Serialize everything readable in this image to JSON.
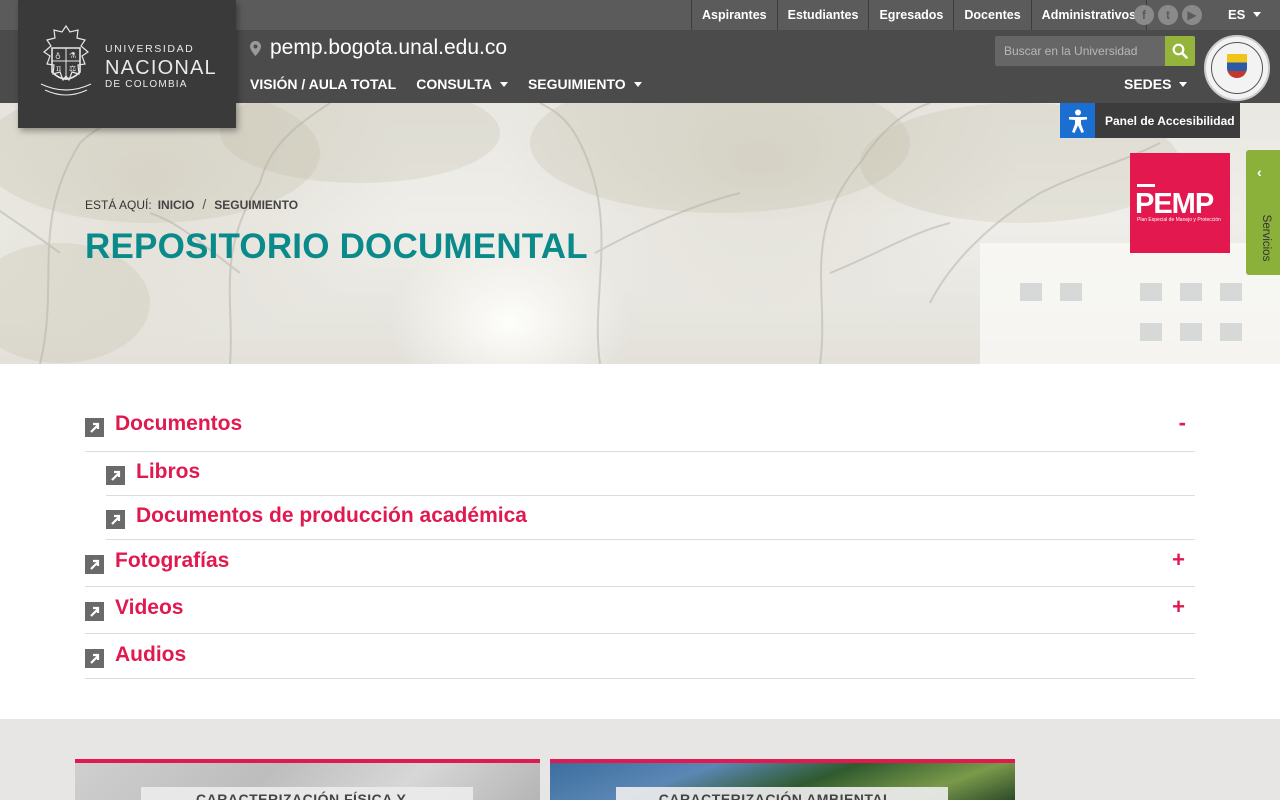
{
  "university": {
    "line1": "UNIVERSIDAD",
    "line2": "NACIONAL",
    "line3": "DE COLOMBIA"
  },
  "top_links": [
    "Aspirantes",
    "Estudiantes",
    "Egresados",
    "Docentes",
    "Administrativos"
  ],
  "social_icons": [
    "facebook-icon",
    "twitter-icon",
    "youtube-icon"
  ],
  "language": "ES",
  "site_url": "pemp.bogota.unal.edu.co",
  "main_nav": [
    "VISIÓN / AULA TOTAL",
    "CONSULTA",
    "SEGUIMIENTO"
  ],
  "search": {
    "placeholder": "Buscar en la Universidad"
  },
  "sedes_label": "SEDES",
  "accessibility_label": "Panel de Accesibilidad",
  "pemp_badge": {
    "word": "PEMP",
    "subtitle": "Plan Especial de Manejo y Protección"
  },
  "servicios_label": "Servicios",
  "breadcrumb": {
    "prefix": "ESTÁ AQUÍ:",
    "items": [
      "INICIO",
      "SEGUIMIENTO"
    ]
  },
  "page_title": "REPOSITORIO DOCUMENTAL",
  "accordion": {
    "documentos": {
      "label": "Documentos",
      "toggle": "-"
    },
    "libros": "Libros",
    "produccion": "Documentos de producción académica",
    "fotografias": {
      "label": "Fotografías",
      "toggle": "+"
    },
    "videos": {
      "label": "Videos",
      "toggle": "+"
    },
    "audios": "Audios"
  },
  "cards": [
    {
      "caption": "CARACTERIZACIÓN FÍSICA Y..."
    },
    {
      "caption": "CARACTERIZACIÓN AMBIENTAL..."
    }
  ],
  "colors": {
    "accent_red": "#e0194f",
    "title_teal": "#0a8a8a",
    "search_green": "#94b43b",
    "servicios_green": "#8bb13b",
    "access_blue": "#1a6fd1"
  }
}
